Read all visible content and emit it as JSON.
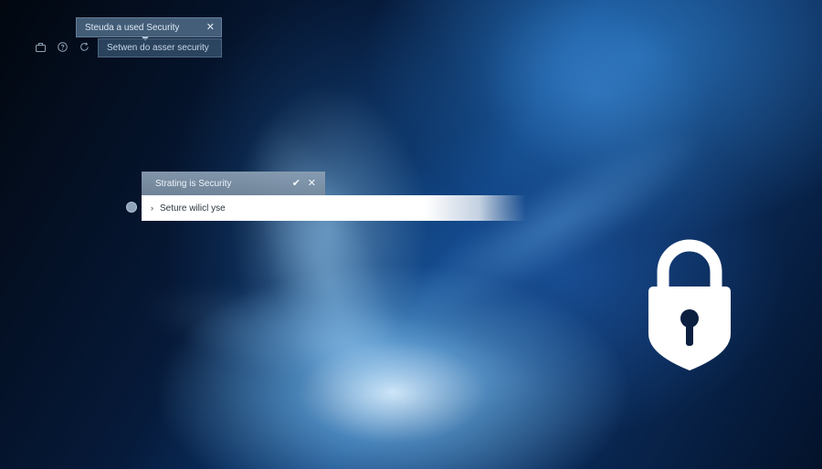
{
  "toolbar": {
    "icons": [
      "briefcase-icon",
      "help-icon",
      "refresh-icon"
    ]
  },
  "tooltip_top": {
    "title": "Steuda a used Security",
    "close_glyph": "✕",
    "subtitle": "Setwen do asser security"
  },
  "dialog": {
    "title": "Strating is Security",
    "confirm_glyph": "✔",
    "close_glyph": "✕",
    "row_chevron": "›",
    "row_label": "Seture wilicl yse"
  },
  "colors": {
    "background_dark": "#03122a",
    "background_glow": "#1e78d2",
    "padlock": "#ffffff",
    "dialog_header": "#8ca0b4"
  },
  "icons": {
    "padlock": "padlock-icon"
  }
}
